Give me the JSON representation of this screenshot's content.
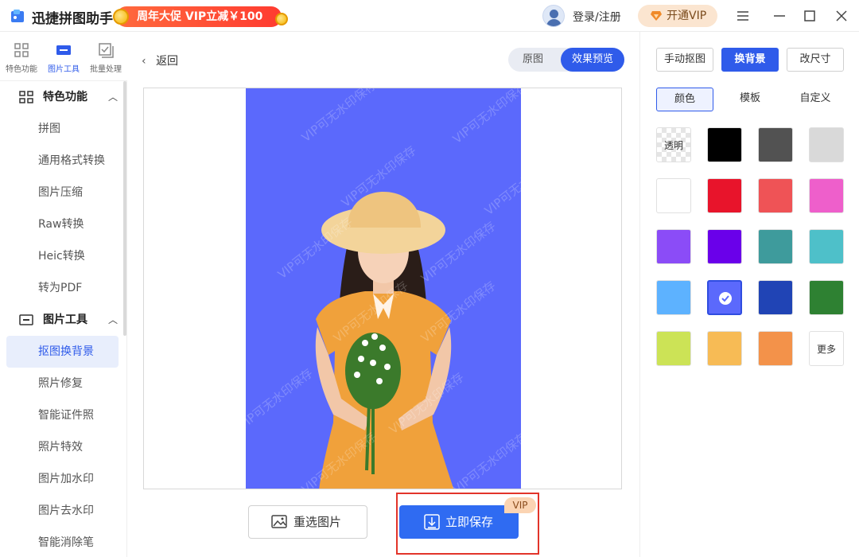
{
  "app": {
    "title": "迅捷拼图助手",
    "promo": "周年大促 VIP立减￥100",
    "login": "登录/注册",
    "vip": "开通VIP"
  },
  "modes": [
    {
      "label": "特色功能"
    },
    {
      "label": "图片工具"
    },
    {
      "label": "批量处理"
    }
  ],
  "sidebar": {
    "group1": "特色功能",
    "group1_items": [
      "拼图",
      "通用格式转换",
      "图片压缩",
      "Raw转换",
      "Heic转换",
      "转为PDF"
    ],
    "group2": "图片工具",
    "group2_items": [
      "抠图换背景",
      "照片修复",
      "智能证件照",
      "照片特效",
      "图片加水印",
      "图片去水印",
      "智能消除笔"
    ]
  },
  "main": {
    "back": "返回",
    "toggle": [
      "原图",
      "效果预览"
    ],
    "watermark": "VIP可无水印保存",
    "reselect": "重选图片",
    "save": "立即保存",
    "save_badge": "VIP"
  },
  "panel": {
    "tabs": [
      "手动抠图",
      "换背景",
      "改尺寸"
    ],
    "subtabs": [
      "颜色",
      "模板",
      "自定义"
    ],
    "transparent_label": "透明",
    "more_label": "更多",
    "colors": [
      "#000000",
      "#525252",
      "#d9d9d9",
      "#ffffff",
      "#e8142b",
      "#ef5356",
      "#ee5fcb",
      "#8b4cf7",
      "#6a00ea",
      "#3e9b9c",
      "#4ec0c9",
      "#5db2ff",
      "#5b69fc",
      "#2044b5",
      "#2e8132",
      "#cce356",
      "#f7bb55",
      "#f3924a"
    ],
    "selected_color": "#5b69fc"
  }
}
